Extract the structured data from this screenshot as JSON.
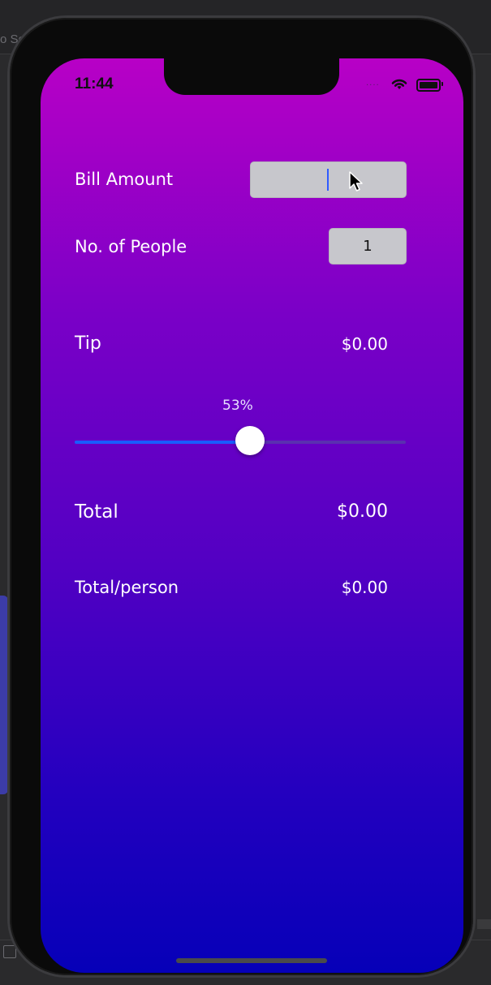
{
  "background": {
    "window_fragment": "o Se"
  },
  "status_bar": {
    "time": "11:44",
    "signal_dots": "····"
  },
  "form": {
    "bill_amount_label": "Bill Amount",
    "bill_amount_value": "",
    "people_label": "No. of People",
    "people_value": "1"
  },
  "tip": {
    "label": "Tip",
    "value": "$0.00",
    "percent_label": "53%",
    "percent": 53
  },
  "total": {
    "label": "Total",
    "value": "$0.00"
  },
  "per_person": {
    "label": "Total/person",
    "value": "$0.00"
  },
  "colors": {
    "gradient_top": "#b800c6",
    "gradient_bottom": "#0600b8",
    "slider_fill": "#1a5cff",
    "slider_track": "#5a2fb0"
  }
}
